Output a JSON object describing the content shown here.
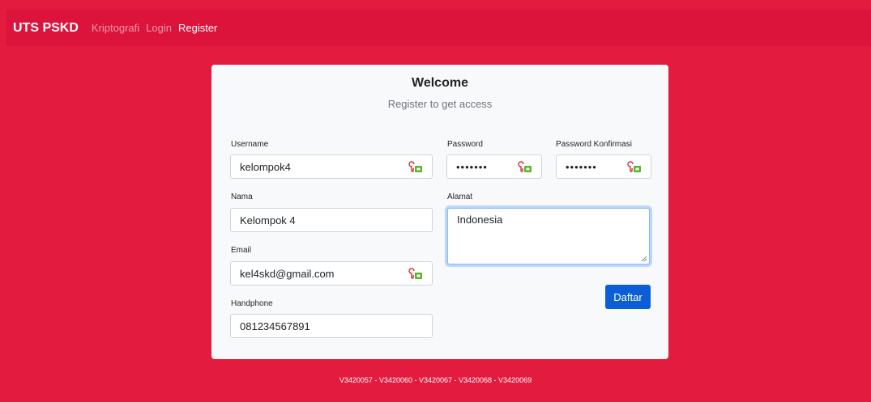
{
  "nav": {
    "brand": "UTS PSKD",
    "links": [
      {
        "label": "Kriptografi",
        "active": false
      },
      {
        "label": "Login",
        "active": false
      },
      {
        "label": "Register",
        "active": true
      }
    ]
  },
  "form": {
    "title": "Welcome",
    "subtitle": "Register to get access",
    "username": {
      "label": "Username",
      "value": "kelompok4"
    },
    "password": {
      "label": "Password",
      "value": "•••••••"
    },
    "password_confirm": {
      "label": "Password Konfirmasi",
      "value": "•••••••"
    },
    "nama": {
      "label": "Nama",
      "value": "Kelompok 4"
    },
    "alamat": {
      "label": "Alamat",
      "value": "Indonesia"
    },
    "email": {
      "label": "Email",
      "value": "kel4skd@gmail.com"
    },
    "handphone": {
      "label": "Handphone",
      "value": "081234567891"
    },
    "submit_label": "Daftar"
  },
  "footer": {
    "text": "V3420057 - V3420060 - V3420067 - V3420068 - V3420069"
  },
  "colors": {
    "background": "#e31b3f",
    "navbar": "#dc143c",
    "card": "#f8f9fa",
    "primary_button": "#0b5ed7",
    "focus_border": "#86b7fe"
  },
  "icons": {
    "password_manager": "password-manager-icon"
  }
}
